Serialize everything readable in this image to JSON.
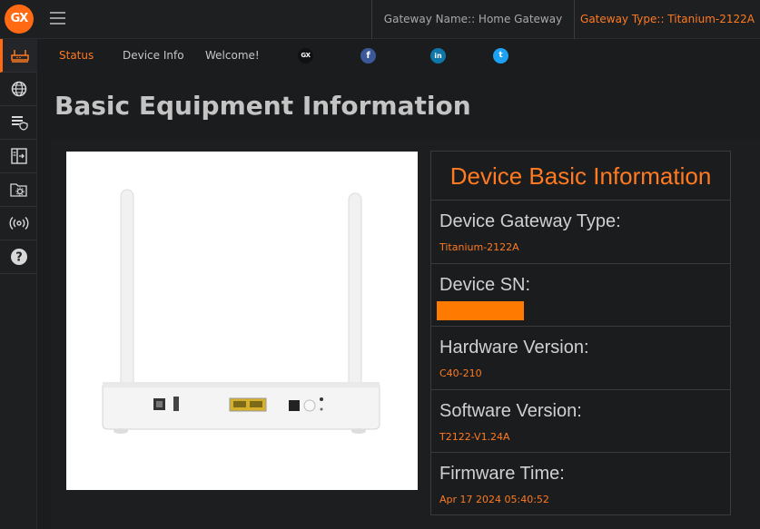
{
  "header": {
    "logo_text": "GX",
    "gateway_name": "Gateway Name:: Home Gateway",
    "gateway_type": "Gateway Type:: Titanium-2122A"
  },
  "sidebar": {
    "items": [
      {
        "icon": "router-icon",
        "active": true
      },
      {
        "icon": "globe-icon"
      },
      {
        "icon": "shield-list-icon"
      },
      {
        "icon": "transfer-icon"
      },
      {
        "icon": "settings-folder-icon"
      },
      {
        "icon": "wireless-icon"
      },
      {
        "icon": "help-icon"
      }
    ]
  },
  "nav": {
    "status": "Status",
    "device_info": "Device Info",
    "welcome": "Welcome!",
    "social": {
      "gx": "GX",
      "facebook": "f",
      "linkedin": "in",
      "twitter": "t"
    }
  },
  "page_title": "Basic Equipment Information",
  "device_card": {
    "title": "Device Basic Information",
    "rows": [
      {
        "label": "Device Gateway Type:",
        "value": "Titanium-2122A"
      },
      {
        "label": "Device SN:",
        "value": ""
      },
      {
        "label": "Hardware Version:",
        "value": "C40-210"
      },
      {
        "label": "Software Version:",
        "value": "T2122-V1.24A"
      },
      {
        "label": "Firmware Time:",
        "value": "Apr 17 2024 05:40:52"
      }
    ]
  },
  "colors": {
    "accent": "#ff7a21",
    "background": "#1b1c1e",
    "redaction": "#ff7a00"
  }
}
